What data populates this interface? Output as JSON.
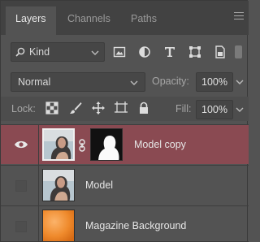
{
  "tabs": [
    {
      "label": "Layers",
      "active": true
    },
    {
      "label": "Channels",
      "active": false
    },
    {
      "label": "Paths",
      "active": false
    }
  ],
  "filter": {
    "kind_label": "Kind",
    "icons": [
      "image-filter-icon",
      "adjustment-filter-icon",
      "type-filter-icon",
      "shape-filter-icon",
      "smart-object-filter-icon"
    ]
  },
  "blend_mode": "Normal",
  "opacity": {
    "label": "Opacity:",
    "value": "100%"
  },
  "lock": {
    "label": "Lock:",
    "icons": [
      "lock-transparent-pixels-icon",
      "lock-image-pixels-icon",
      "lock-position-icon",
      "prevent-autonest-icon",
      "lock-all-icon"
    ]
  },
  "fill": {
    "label": "Fill:",
    "value": "100%"
  },
  "layers": [
    {
      "name": "Model copy",
      "visible": true,
      "selected": true,
      "has_mask": true
    },
    {
      "name": "Model",
      "visible": false,
      "selected": false,
      "has_mask": false
    },
    {
      "name": "Magazine Background",
      "visible": false,
      "selected": false,
      "has_mask": false
    }
  ],
  "colors": {
    "panel_bg": "#535353",
    "tabbar_bg": "#424242",
    "selected_layer": "#8a4a52",
    "text": "#e6e6e6"
  }
}
